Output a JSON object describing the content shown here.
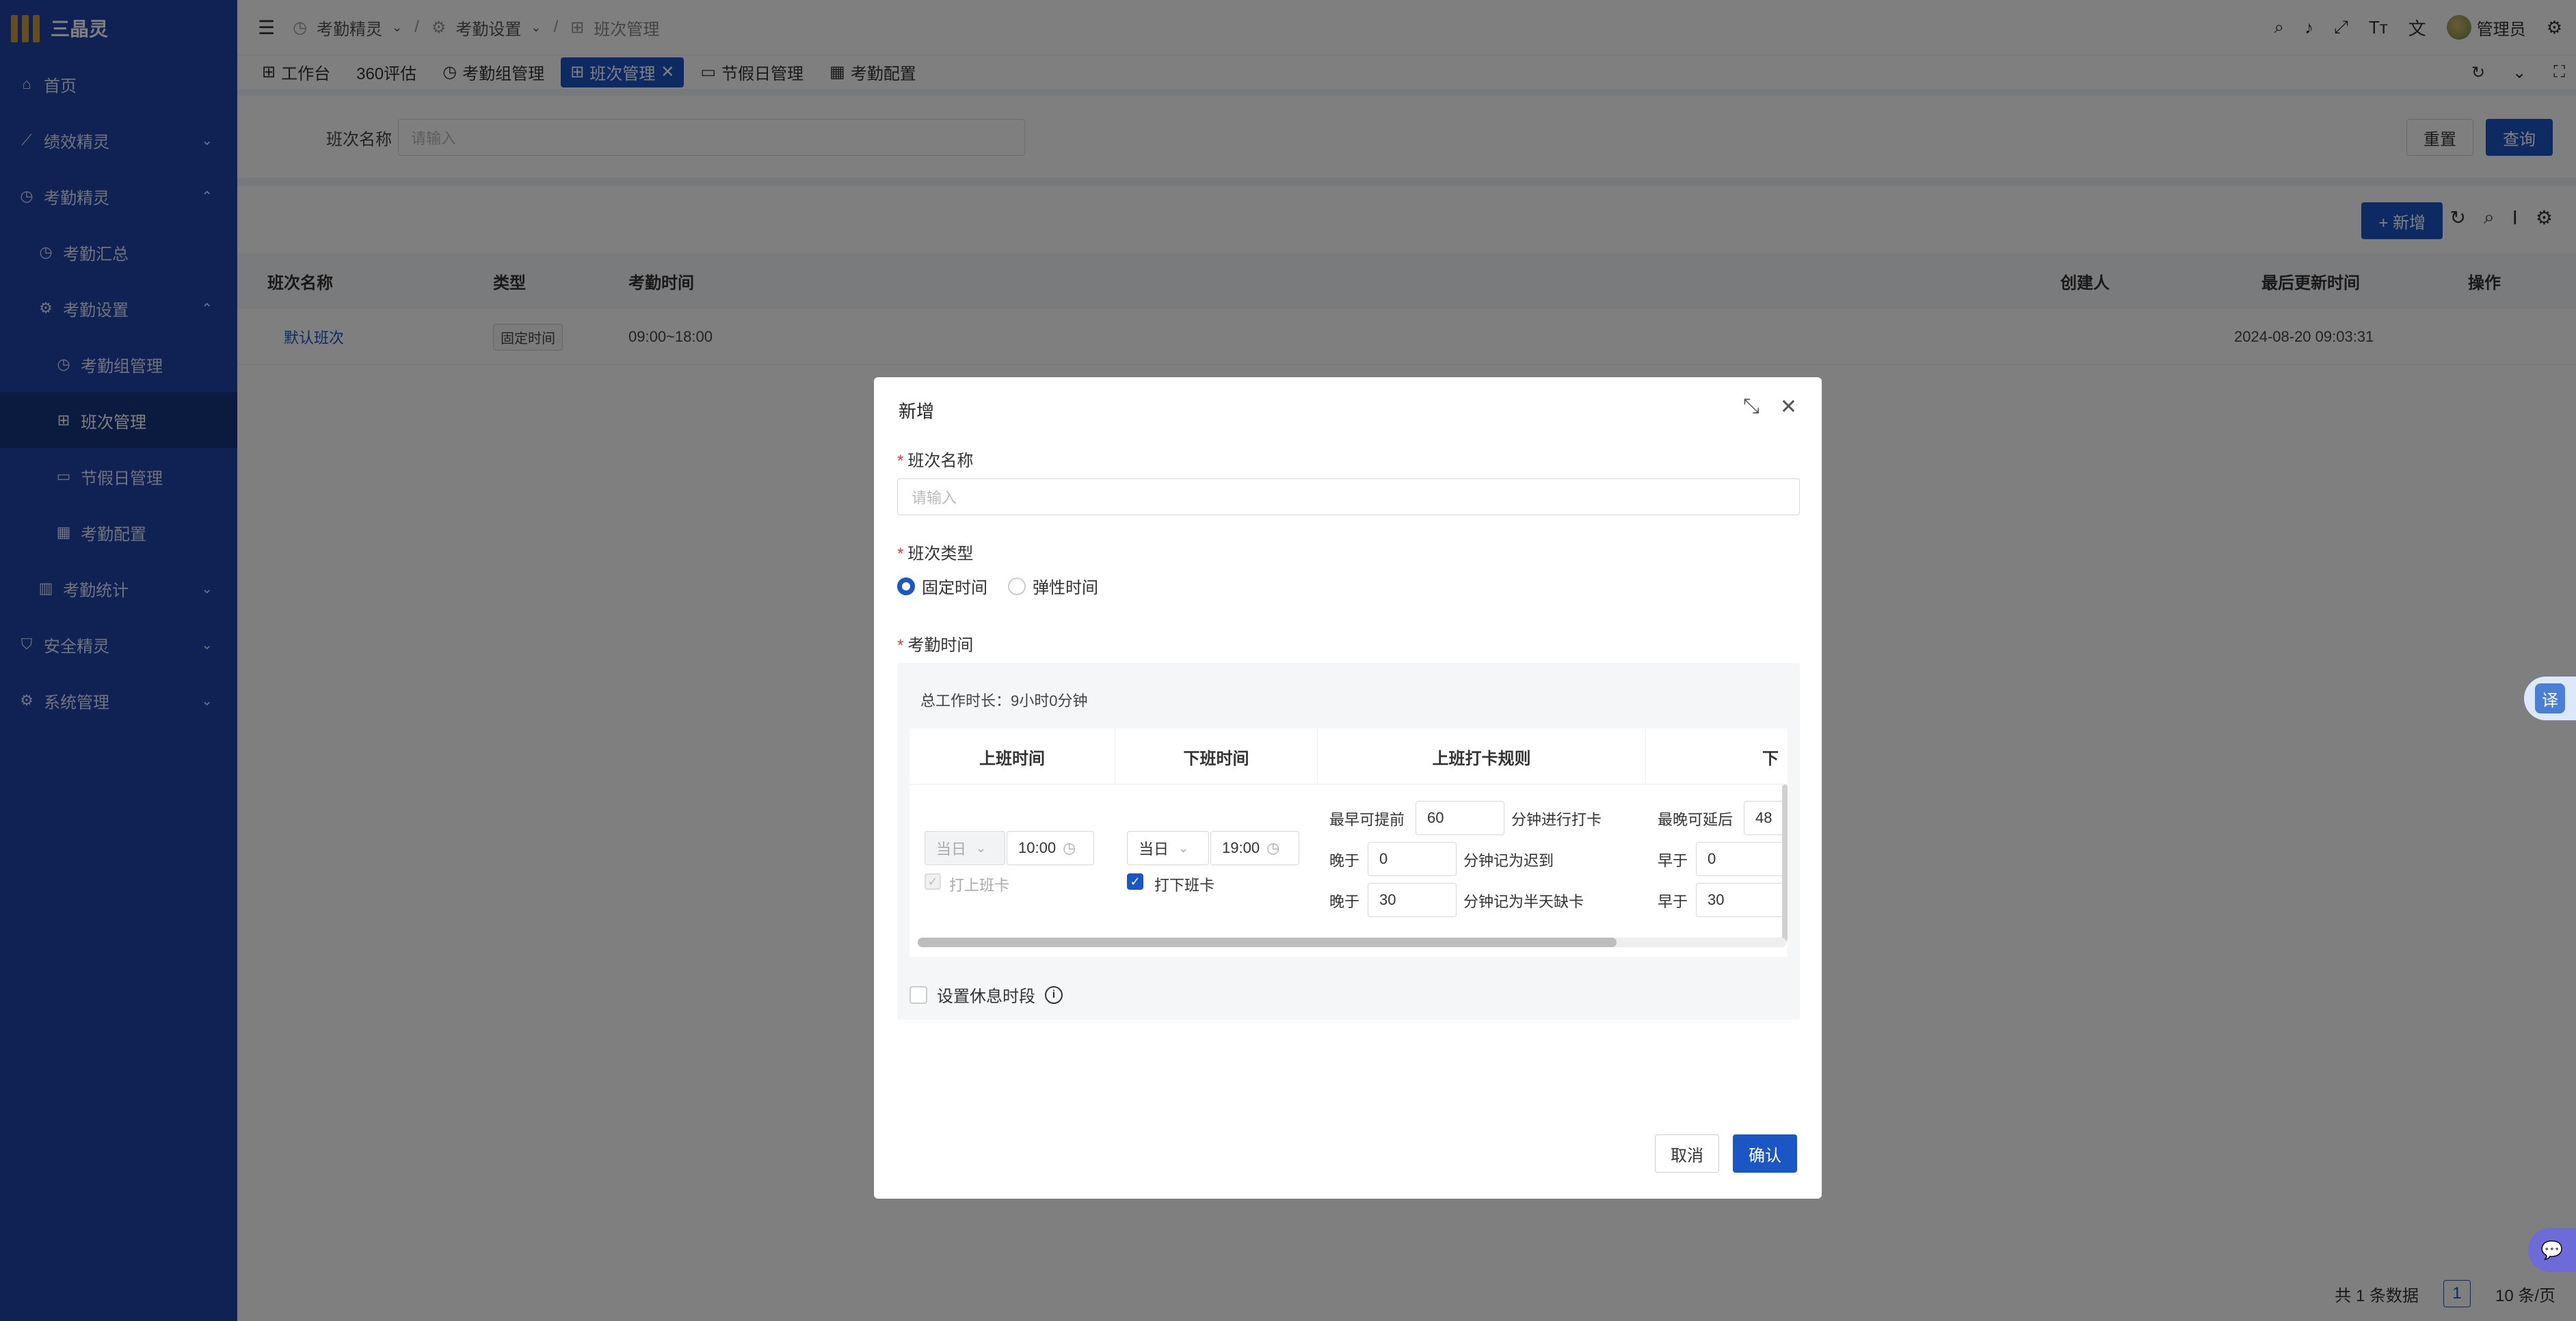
{
  "brand": {
    "name": "三晶灵"
  },
  "sidebar": {
    "items": [
      {
        "label": "首页",
        "icon": "home-icon"
      },
      {
        "label": "绩效精灵",
        "icon": "chart-line-icon"
      },
      {
        "label": "考勤精灵",
        "icon": "clock-icon"
      },
      {
        "label": "考勤汇总",
        "icon": "clock-icon"
      },
      {
        "label": "考勤设置",
        "icon": "gear-icon"
      },
      {
        "label": "考勤组管理",
        "icon": "clock-icon"
      },
      {
        "label": "班次管理",
        "icon": "grid-icon"
      },
      {
        "label": "节假日管理",
        "icon": "calendar-icon"
      },
      {
        "label": "考勤配置",
        "icon": "apps-icon"
      },
      {
        "label": "考勤统计",
        "icon": "bar-chart-icon"
      },
      {
        "label": "安全精灵",
        "icon": "shield-icon"
      },
      {
        "label": "系统管理",
        "icon": "gear-icon"
      }
    ]
  },
  "header": {
    "breadcrumb": [
      "考勤精灵",
      "考勤设置",
      "班次管理"
    ],
    "user": "管理员"
  },
  "tabs": [
    {
      "label": "工作台"
    },
    {
      "label": "360评估"
    },
    {
      "label": "考勤组管理"
    },
    {
      "label": "班次管理"
    },
    {
      "label": "节假日管理"
    },
    {
      "label": "考勤配置"
    }
  ],
  "search": {
    "label": "班次名称",
    "placeholder": "请输入",
    "reset": "重置",
    "query": "查询"
  },
  "toolbar": {
    "add": "+ 新增"
  },
  "table": {
    "columns": [
      "班次名称",
      "类型",
      "考勤时间",
      "创建人",
      "最后更新时间",
      "操作"
    ],
    "rows": [
      {
        "name": "默认班次",
        "type": "固定时间",
        "time": "09:00~18:00",
        "creator": "",
        "updated": "2024-08-20 09:03:31"
      }
    ]
  },
  "pager": {
    "total": "共 1 条数据",
    "page": "1",
    "size": "10 条/页"
  },
  "float": {
    "translate": "译"
  },
  "modal": {
    "title": "新增",
    "name_label": "班次名称",
    "name_placeholder": "请输入",
    "type_label": "班次类型",
    "type_fixed": "固定时间",
    "type_flex": "弹性时间",
    "time_label": "考勤时间",
    "total": "总工作时长：9小时0分钟",
    "inner_columns": [
      "上班时间",
      "下班时间",
      "上班打卡规则",
      "下"
    ],
    "on_day": "当日",
    "on_time": "10:00",
    "on_punch": "打上班卡",
    "off_day": "当日",
    "off_time": "19:00",
    "off_punch": "打下班卡",
    "rule_earliest": "最早可提前",
    "rule_earliest_val": "60",
    "rule_earliest_suffix": "分钟进行打卡",
    "rule_late": "晚于",
    "rule_late_val": "0",
    "rule_late_suffix": "分钟记为迟到",
    "rule_half": "晚于",
    "rule_half_val": "30",
    "rule_half_suffix": "分钟记为半天缺卡",
    "off_latest": "最晚可延后",
    "off_latest_val": "48",
    "off_early": "早于",
    "off_early_val": "0",
    "off_early2": "早于",
    "off_early2_val": "30",
    "rest_label": "设置休息时段",
    "cancel": "取消",
    "confirm": "确认"
  },
  "colors": {
    "primary": "#1a56c4",
    "sidebar": "#2143a8"
  }
}
